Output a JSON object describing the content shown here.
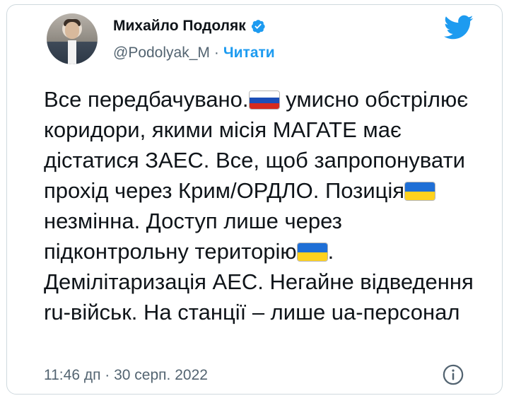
{
  "author": {
    "name": "Михайло Подоляк",
    "handle": "@Podolyak_M",
    "separator": "·",
    "follow_label": "Читати"
  },
  "tweet": {
    "segments": [
      "Все передбачувано.",
      "умисно обстрілює коридори, якими місія МАГАТЕ має дістатися ЗАЕС. Все, щоб запропонувати прохід через Крим/ОРДЛО. Позиція",
      "незмінна. Доступ лише через підконтрольну територію",
      ". Демілітаризація АЕС. Негайне відведення ru-військ. На станції – лише ua-персонал"
    ],
    "flags": [
      "russia-flag-emoji",
      "ukraine-flag-emoji",
      "ukraine-flag-emoji"
    ]
  },
  "meta": {
    "timestamp": "11:46 дп · 30 серп. 2022"
  },
  "colors": {
    "accent": "#1d9bf0",
    "text": "#0f1419",
    "secondary": "#536471",
    "border": "#cfd9de"
  },
  "icons": [
    "verified-badge-icon",
    "twitter-bird-icon",
    "info-icon"
  ]
}
